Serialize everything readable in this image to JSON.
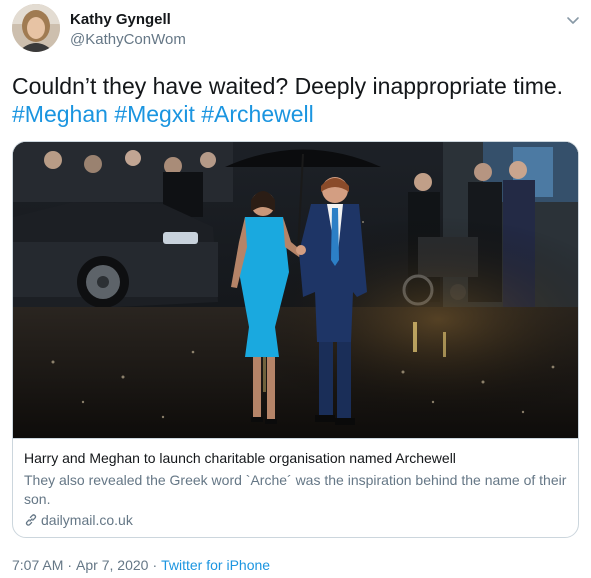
{
  "author": {
    "display_name": "Kathy Gyngell",
    "handle": "@KathyConWom",
    "avatar_icon": "user-avatar-photo"
  },
  "tweet": {
    "text": "Couldn’t they have waited? Deeply inappropriate time.",
    "hashtags": [
      "#Meghan",
      "#Megxit",
      "#Archewell"
    ]
  },
  "card": {
    "image_alt": "couple-walking-in-rain-photo",
    "title": "Harry and Meghan to launch charitable organisation named Archewell",
    "description": "They also revealed the Greek word `Arche´ was the inspiration behind the name of their son.",
    "domain": "dailymail.co.uk",
    "domain_icon": "link-icon"
  },
  "meta": {
    "time": "7:07 AM",
    "separator": "·",
    "date": "Apr 7, 2020",
    "source": "Twitter for iPhone"
  },
  "colors": {
    "link": "#1b95e0",
    "secondary_text": "#657786",
    "primary_text": "#14171a",
    "border": "#ccd6dd",
    "dress": "#1aa9df",
    "suit": "#1e3566"
  }
}
